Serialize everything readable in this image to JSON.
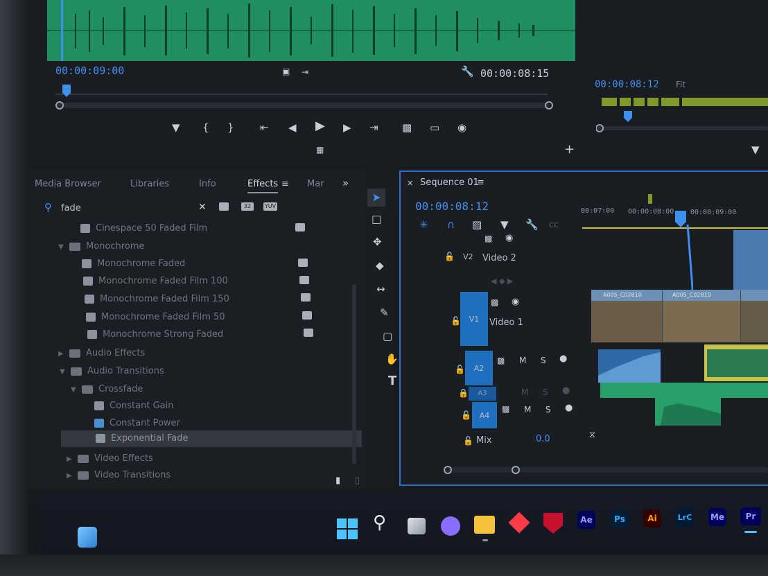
{
  "source_monitor": {
    "timecode_left": "00:00:09:00",
    "timecode_right": "00:00:08:15"
  },
  "program_monitor": {
    "timecode": "00:00:08:12",
    "fit_label": "Fit"
  },
  "effects_panel": {
    "tabs": [
      "Media Browser",
      "Libraries",
      "Info",
      "Effects",
      "Mar"
    ],
    "active_tab": "Effects",
    "search_value": "fade",
    "filter_badges": [
      "32",
      "YUV"
    ],
    "tree": [
      {
        "label": "Cinespace 50 Faded Film",
        "kind": "effect"
      },
      {
        "label": "Monochrome",
        "kind": "folder"
      },
      {
        "label": "Monochrome Faded",
        "kind": "effect"
      },
      {
        "label": "Monochrome Faded Film 100",
        "kind": "effect"
      },
      {
        "label": "Monochrome Faded Film 150",
        "kind": "effect"
      },
      {
        "label": "Monochrome Faded Film 50",
        "kind": "effect"
      },
      {
        "label": "Monochrome Strong Faded",
        "kind": "effect"
      },
      {
        "label": "Audio Effects",
        "kind": "folder"
      },
      {
        "label": "Audio Transitions",
        "kind": "folder"
      },
      {
        "label": "Crossfade",
        "kind": "folder"
      },
      {
        "label": "Constant Gain",
        "kind": "transition"
      },
      {
        "label": "Constant Power",
        "kind": "transition"
      },
      {
        "label": "Exponential Fade",
        "kind": "transition"
      },
      {
        "label": "Video Effects",
        "kind": "folder"
      },
      {
        "label": "Video Transitions",
        "kind": "folder"
      }
    ]
  },
  "sequence": {
    "name": "Sequence 01",
    "timecode": "00:00:08:12",
    "ruler": [
      "00:07:00",
      "00:00:08:00",
      "00:00:09:00"
    ],
    "tracks": {
      "v2": {
        "id": "V2",
        "name": "Video 2"
      },
      "v1": {
        "id": "V1",
        "name": "Video 1"
      },
      "a2": {
        "id": "A2"
      },
      "a3": {
        "id": "A3"
      },
      "a4": {
        "id": "A4"
      },
      "mix": {
        "label": "Mix",
        "value": "0.0"
      }
    },
    "track_buttons": {
      "mute": "M",
      "solo": "S"
    },
    "clips": {
      "v1_a": "A005_C02810",
      "v1_b": "A005_C02810"
    }
  },
  "taskbar": {
    "apps": [
      {
        "name": "After Effects",
        "abbr": "Ae",
        "color": "#00005b",
        "fg": "#9999ff"
      },
      {
        "name": "Photoshop",
        "abbr": "Ps",
        "color": "#001e36",
        "fg": "#31a8ff"
      },
      {
        "name": "Illustrator",
        "abbr": "Ai",
        "color": "#330000",
        "fg": "#ff9a00"
      },
      {
        "name": "Lightroom Classic",
        "abbr": "LrC",
        "color": "#001a33",
        "fg": "#31a8ff"
      },
      {
        "name": "Media Encoder",
        "abbr": "Me",
        "color": "#00005b",
        "fg": "#9999ff"
      },
      {
        "name": "Premiere Pro",
        "abbr": "Pr",
        "color": "#00005b",
        "fg": "#9999ff"
      }
    ]
  },
  "colors": {
    "accent_blue": "#3f8ff0",
    "waveform_green": "#1f8f5f",
    "audio_clip_green": "#27a06a",
    "video_track_blue": "#1e6fbf"
  }
}
